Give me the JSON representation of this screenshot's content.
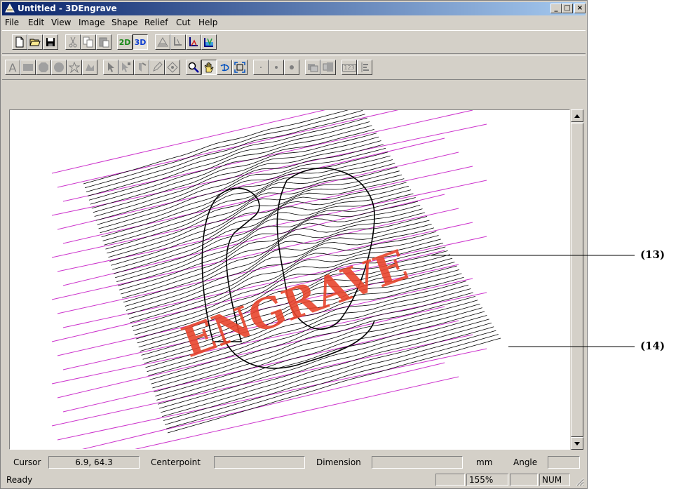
{
  "window": {
    "title": "Untitled - 3DEngrave",
    "controls": {
      "minimize": "_",
      "maximize": "□",
      "close": "×"
    }
  },
  "menu": [
    "File",
    "Edit",
    "View",
    "Image",
    "Shape",
    "Relief",
    "Cut",
    "Help"
  ],
  "toolbar1": {
    "view_2d_label": "2D",
    "view_3d_label": "3D",
    "icons": [
      "new-file-icon",
      "open-folder-icon",
      "save-disk-icon",
      "cut-scissors-icon",
      "copy-icon",
      "paste-icon",
      "view-2d-icon",
      "view-3d-icon",
      "relief-surface-icon",
      "toolpath-icon",
      "cut-profile-icon",
      "engrave-preview-icon"
    ]
  },
  "toolbar2": {
    "icons": [
      "text-icon",
      "rectangle-icon",
      "polygon-icon",
      "circle-icon",
      "star-icon",
      "shape-group-icon",
      "select-arrow-icon",
      "node-edit-icon",
      "rotate-icon",
      "pencil-icon",
      "fill-icon",
      "zoom-icon",
      "pan-hand-icon",
      "orbit-icon",
      "fit-window-icon",
      "point-small-icon",
      "point-medium-icon",
      "point-large-icon",
      "layer-front-icon",
      "layer-back-icon",
      "numeric-input-icon",
      "align-icon"
    ],
    "numeric_label": "123"
  },
  "canvas": {
    "engraved_text": "ENGRAVE",
    "colors": {
      "scanline": "#000000",
      "guide": "#cc33cc",
      "text": "#e8452d"
    }
  },
  "status": {
    "cursor_label": "Cursor",
    "cursor_value": "6.9, 64.3",
    "centerpoint_label": "Centerpoint",
    "centerpoint_value": "",
    "dimension_label": "Dimension",
    "dimension_value": "",
    "unit": "mm",
    "angle_label": "Angle",
    "angle_value": "",
    "ready": "Ready",
    "zoom": "155%",
    "num": "NUM"
  },
  "callouts": {
    "c13": "(13)",
    "c14": "(14)"
  }
}
